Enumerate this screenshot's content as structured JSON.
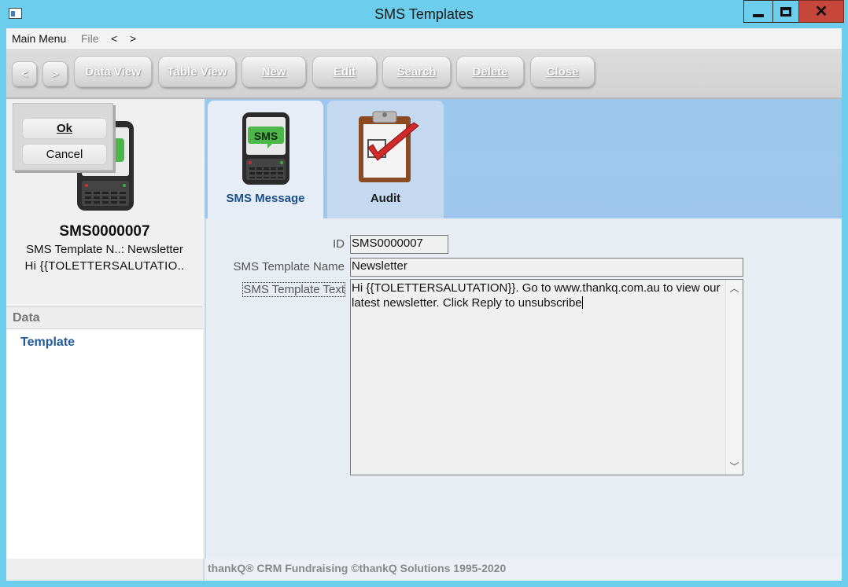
{
  "window": {
    "title": "SMS Templates"
  },
  "menu": {
    "main": "Main Menu",
    "file": "File",
    "back": "<",
    "forward": ">"
  },
  "toolbar": {
    "back": "<",
    "forward": ">",
    "data_view": "Data View",
    "table_view": "Table View",
    "new": "New",
    "edit": "Edit",
    "search": "Search",
    "delete": "Delete",
    "close": "Close"
  },
  "popup": {
    "ok": "Ok",
    "cancel": "Cancel"
  },
  "summary": {
    "id": "SMS0000007",
    "line1": "SMS Template N..: Newsletter",
    "line2": "Hi {{TOLETTERSALUTATIO.."
  },
  "data_section": {
    "header": "Data",
    "items": [
      {
        "label": "Template"
      }
    ]
  },
  "tabs": [
    {
      "label": "SMS Message",
      "icon_text": "SMS",
      "icon": "sms-phone-icon"
    },
    {
      "label": "Audit",
      "icon": "clipboard-check-icon"
    }
  ],
  "form": {
    "id_label": "ID",
    "id_value": "SMS0000007",
    "name_label": "SMS Template Name",
    "name_value": "Newsletter",
    "text_label": "SMS Template Text",
    "text_value": "Hi {{TOLETTERSALUTATION}}. Go to www.thankq.com.au to view our latest newsletter. Click Reply to unsubscribe"
  },
  "footer": {
    "text": "thankQ® CRM Fundraising ©thankQ Solutions 1995-2020"
  }
}
